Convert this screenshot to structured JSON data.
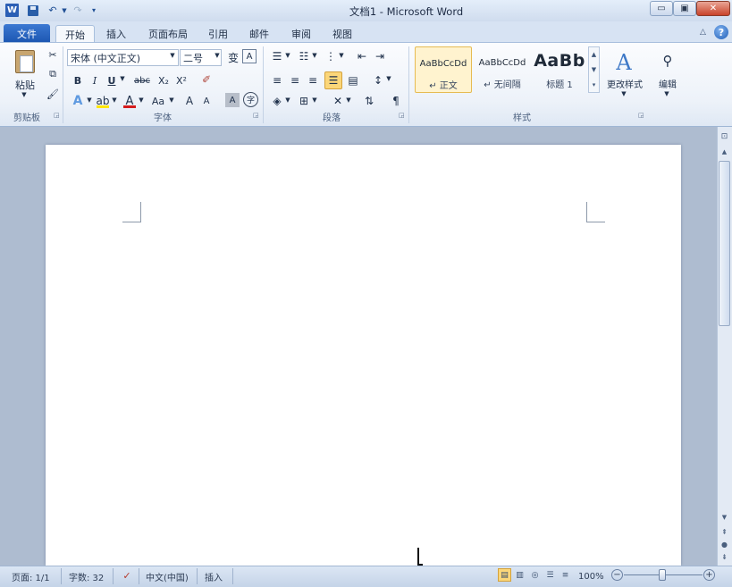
{
  "window": {
    "title": "文档1 - Microsoft Word",
    "app_logo": "W",
    "controls": {
      "minimize": "▭",
      "maximize": "▣",
      "close": "✕"
    }
  },
  "quick_access": {
    "icons": [
      "word-logo",
      "save-icon",
      "undo-icon",
      "redo-icon",
      "customize-qat-icon"
    ],
    "undo_glyph": "↶",
    "redo_glyph": "↷"
  },
  "tabs": {
    "file": "文件",
    "items": [
      "开始",
      "插入",
      "页面布局",
      "引用",
      "邮件",
      "审阅",
      "视图"
    ],
    "active": "开始",
    "help": "?"
  },
  "ribbon": {
    "clipboard": {
      "label": "剪贴板",
      "paste": "粘贴"
    },
    "font": {
      "label": "字体",
      "font_name": "宋体 (中文正文)",
      "font_size": "二号",
      "phonetic": "变",
      "char_border": "A",
      "bold": "B",
      "italic": "I",
      "underline": "U",
      "strikethrough": "abc",
      "subscript": "X₂",
      "superscript": "X²",
      "text_effect": "A",
      "highlight": "ab",
      "font_color": "A",
      "change_case": "Aa",
      "grow": "A",
      "shrink": "A",
      "char_shading": "A",
      "enclose": "字",
      "highlight_color": "#ffe600",
      "font_color_value": "#d41c1c"
    },
    "paragraph": {
      "label": "段落"
    },
    "styles": {
      "label": "样式",
      "tiles": [
        {
          "sample": "AaBbCcDd",
          "name": "↵ 正文",
          "selected": true
        },
        {
          "sample": "AaBbCcDd",
          "name": "↵ 无间隔",
          "selected": false
        },
        {
          "sample": "AaBb",
          "name": "标题 1",
          "selected": false
        }
      ],
      "change_styles": "更改样式"
    },
    "editing": {
      "label": "编辑"
    }
  },
  "status_bar": {
    "page": "页面: 1/1",
    "word_count": "字数: 32",
    "language": "中文(中国)",
    "insert_mode": "插入",
    "zoom": "100%",
    "zoom_level_percent": 100
  },
  "colors": {
    "accent": "#2b5fb5",
    "selected_style_bg": "#fff3cf",
    "workspace_bg": "#aebcd0"
  }
}
